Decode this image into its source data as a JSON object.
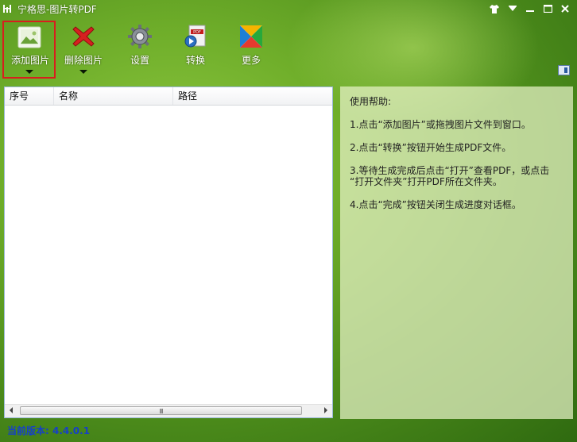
{
  "window": {
    "title": "宁格思-图片转PDF",
    "controls": [
      {
        "name": "skin-icon",
        "glyph": "👕"
      },
      {
        "name": "menu-dropdown-icon",
        "glyph": "▾"
      },
      {
        "name": "minimize-icon",
        "glyph": "▬"
      },
      {
        "name": "maximize-icon",
        "glyph": "☐"
      },
      {
        "name": "close-icon",
        "glyph": "✕"
      }
    ]
  },
  "toolbar": {
    "add_images": "添加图片",
    "delete_images": "删除图片",
    "settings": "设置",
    "convert": "转换",
    "more": "更多"
  },
  "list": {
    "columns": [
      "序号",
      "名称",
      "路径"
    ],
    "rows": [],
    "scrollbar_grip": "III"
  },
  "help": {
    "title": "使用帮助:",
    "lines": [
      "1.点击“添加图片”或拖拽图片文件到窗口。",
      "2.点击“转换”按钮开始生成PDF文件。",
      "3.等待生成完成后点击“打开”查看PDF，或点击",
      "“打开文件夹”打开PDF所在文件夹。",
      "4.点击“完成”按钮关闭生成进度对话框。"
    ]
  },
  "status": {
    "version": "当前版本: 4.4.0.1"
  },
  "colors": {
    "selected_border": "#d81e1e",
    "version_text": "#1640c8",
    "background": "#6fae2a"
  }
}
